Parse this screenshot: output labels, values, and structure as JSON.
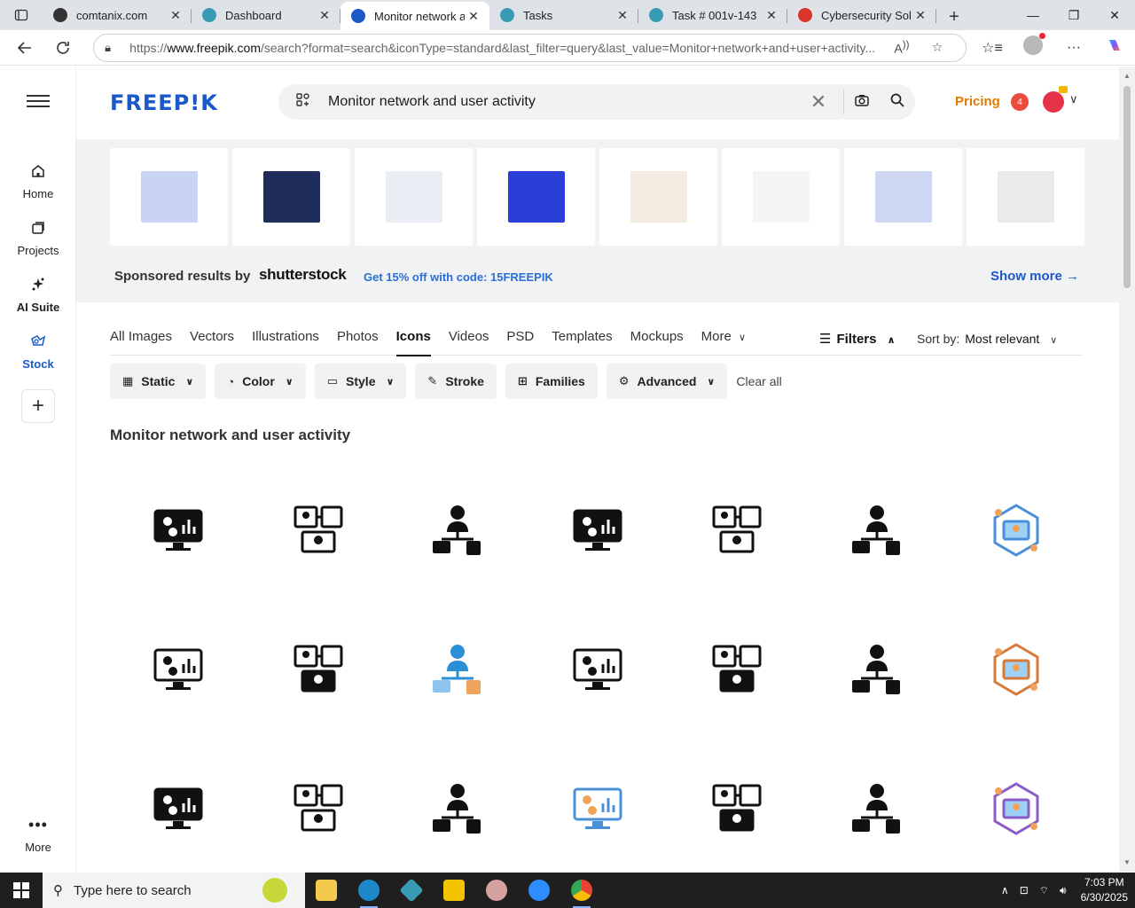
{
  "browser": {
    "tabs": [
      {
        "title": "comtanix.com",
        "active": false,
        "fav_color": "#333333"
      },
      {
        "title": "Dashboard",
        "active": false,
        "fav_color": "#3a9bb5"
      },
      {
        "title": "Monitor network and",
        "active": true,
        "fav_color": "#1b59c8"
      },
      {
        "title": "Tasks",
        "active": false,
        "fav_color": "#3a9bb5"
      },
      {
        "title": "Task # 001v-143",
        "active": false,
        "fav_color": "#3a9bb5"
      },
      {
        "title": "Cybersecurity Soluti",
        "active": false,
        "fav_color": "#d9352b"
      }
    ],
    "url_prefix": "https://",
    "url_domain": "www.freepik.com",
    "url_rest": "/search?format=search&iconType=standard&last_filter=query&last_value=Monitor+network+and+user+activity..."
  },
  "sidebar": {
    "home": "Home",
    "projects": "Projects",
    "ai_suite": "AI Suite",
    "stock": "Stock",
    "more": "More"
  },
  "header": {
    "logo": "FREEP!K",
    "search_value": "Monitor network and user activity",
    "pricing": "Pricing",
    "notif_count": "4"
  },
  "sponsored": {
    "label": "Sponsored results by",
    "brand": "shutterstock",
    "promo": "Get 15% off with code: 15FREEPIK",
    "show_more": "Show more →",
    "thumb_colors": [
      "#c9d4f5",
      "#1f2c5c",
      "#e9eef5",
      "#2a3fd8",
      "#f4eadf",
      "#f5f5f5",
      "#cfd8f2",
      "#eaeaea"
    ]
  },
  "type_tabs": [
    "All Images",
    "Vectors",
    "Illustrations",
    "Photos",
    "Icons",
    "Videos",
    "PSD",
    "Templates",
    "Mockups",
    "More"
  ],
  "active_type": "Icons",
  "filters_label": "Filters",
  "sort": {
    "label": "Sort by:",
    "value": "Most relevant"
  },
  "chips": [
    {
      "label": "Static",
      "icon": "static-icon",
      "chevron": true
    },
    {
      "label": "Color",
      "icon": "palette-icon",
      "chevron": true
    },
    {
      "label": "Style",
      "icon": "paint-roller-icon",
      "chevron": true
    },
    {
      "label": "Stroke",
      "icon": "pen-icon",
      "chevron": false
    },
    {
      "label": "Families",
      "icon": "grid-icon",
      "chevron": false
    },
    {
      "label": "Advanced",
      "icon": "cog-icon",
      "chevron": true
    }
  ],
  "clear_all": "Clear all",
  "results_title": "Monitor network and user activity",
  "icons": [
    {
      "name": "monitor-users-chart-icon",
      "style": "solid",
      "color": "#111111"
    },
    {
      "name": "devices-users-network-icon",
      "style": "outline",
      "color": "#111111"
    },
    {
      "name": "user-hierarchy-devices-icon",
      "style": "solid",
      "color": "#111111"
    },
    {
      "name": "monitor-network-hexagon-icon",
      "style": "solid",
      "color": "#111111"
    },
    {
      "name": "computer-user-link-icon",
      "style": "outline",
      "color": "#111111"
    },
    {
      "name": "users-wifi-icon",
      "style": "solid",
      "color": "#111111"
    },
    {
      "name": "user-org-chart-icon",
      "style": "color",
      "color": "#4a90d9"
    },
    {
      "name": "hexagon-network-outline-icon",
      "style": "outline",
      "color": "#111111"
    },
    {
      "name": "user-device-exchange-icon",
      "style": "solid",
      "color": "#111111"
    },
    {
      "name": "monitor-blue-chart-icon",
      "style": "color",
      "color": "#2a8fd4"
    },
    {
      "name": "monitor-users-outline-icon",
      "style": "outline",
      "color": "#111111"
    },
    {
      "name": "bar-chart-user-icon",
      "style": "solid",
      "color": "#111111"
    },
    {
      "name": "bar-chart-user-outline-icon",
      "style": "outline",
      "color": "#111111"
    },
    {
      "name": "hexagon-network-color-icon",
      "style": "color",
      "color": "#d77a3a"
    },
    {
      "name": "presentation-users-icon",
      "style": "solid",
      "color": "#111111"
    },
    {
      "name": "users-laptop-wifi-icon",
      "style": "outline",
      "color": "#111111"
    },
    {
      "name": "dashboard-user-wifi-icon",
      "style": "solid",
      "color": "#111111"
    },
    {
      "name": "laptop-users-color-icon",
      "style": "color",
      "color": "#4a90d9"
    },
    {
      "name": "monitor-team-network-icon",
      "style": "solid",
      "color": "#111111"
    },
    {
      "name": "user-cloud-devices-icon",
      "style": "solid",
      "color": "#111111"
    },
    {
      "name": "monitor-purple-chart-icon",
      "style": "color",
      "color": "#8a5cc7"
    }
  ],
  "taskbar": {
    "search_placeholder": "Type here to search",
    "time": "7:03 PM",
    "date": "6/30/2025"
  }
}
